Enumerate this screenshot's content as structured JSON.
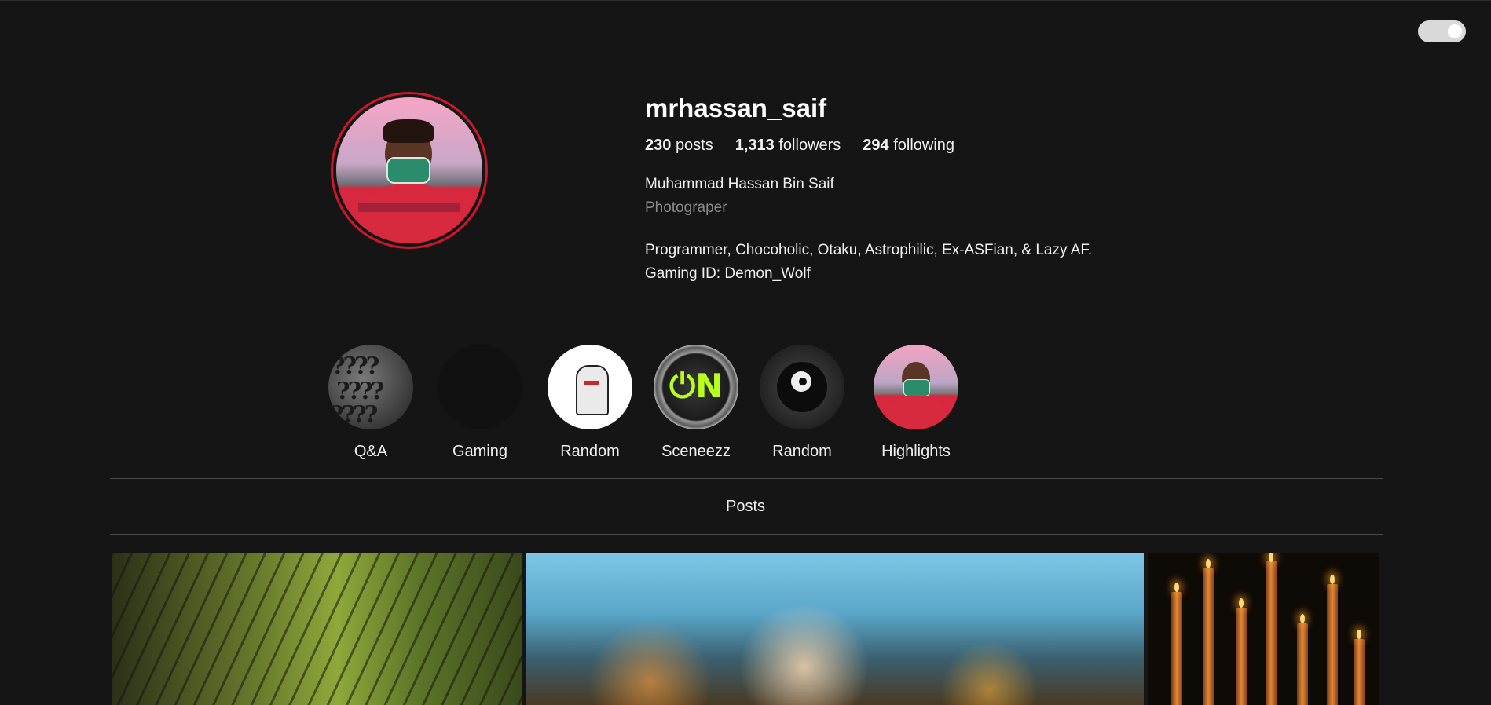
{
  "profile": {
    "username": "mrhassan_saif",
    "stats": {
      "posts_count": "230",
      "posts_label": "posts",
      "followers_count": "1,313",
      "followers_label": "followers",
      "following_count": "294",
      "following_label": "following"
    },
    "full_name": "Muhammad Hassan Bin Saif",
    "category": "Photograper",
    "bio_line1": "Programmer, Chocoholic, Otaku, Astrophilic, Ex-ASFian, & Lazy AF.",
    "bio_line2": "Gaming ID: Demon_Wolf"
  },
  "highlights": [
    {
      "label": "Q&A"
    },
    {
      "label": "Gaming"
    },
    {
      "label": "Random"
    },
    {
      "label": "Sceneezz"
    },
    {
      "label": "Random"
    },
    {
      "label": "Highlights"
    }
  ],
  "tabs": {
    "posts_label": "Posts"
  },
  "theme": {
    "background": "#151515",
    "story_ring": "#d0162b",
    "toggle": "#d9d9d9",
    "muted_text": "#8a8a8a"
  },
  "posts": [
    {
      "icon": "forest-path-photo"
    },
    {
      "icon": "rainy-window-photo"
    },
    {
      "icon": "candles-photo"
    }
  ]
}
